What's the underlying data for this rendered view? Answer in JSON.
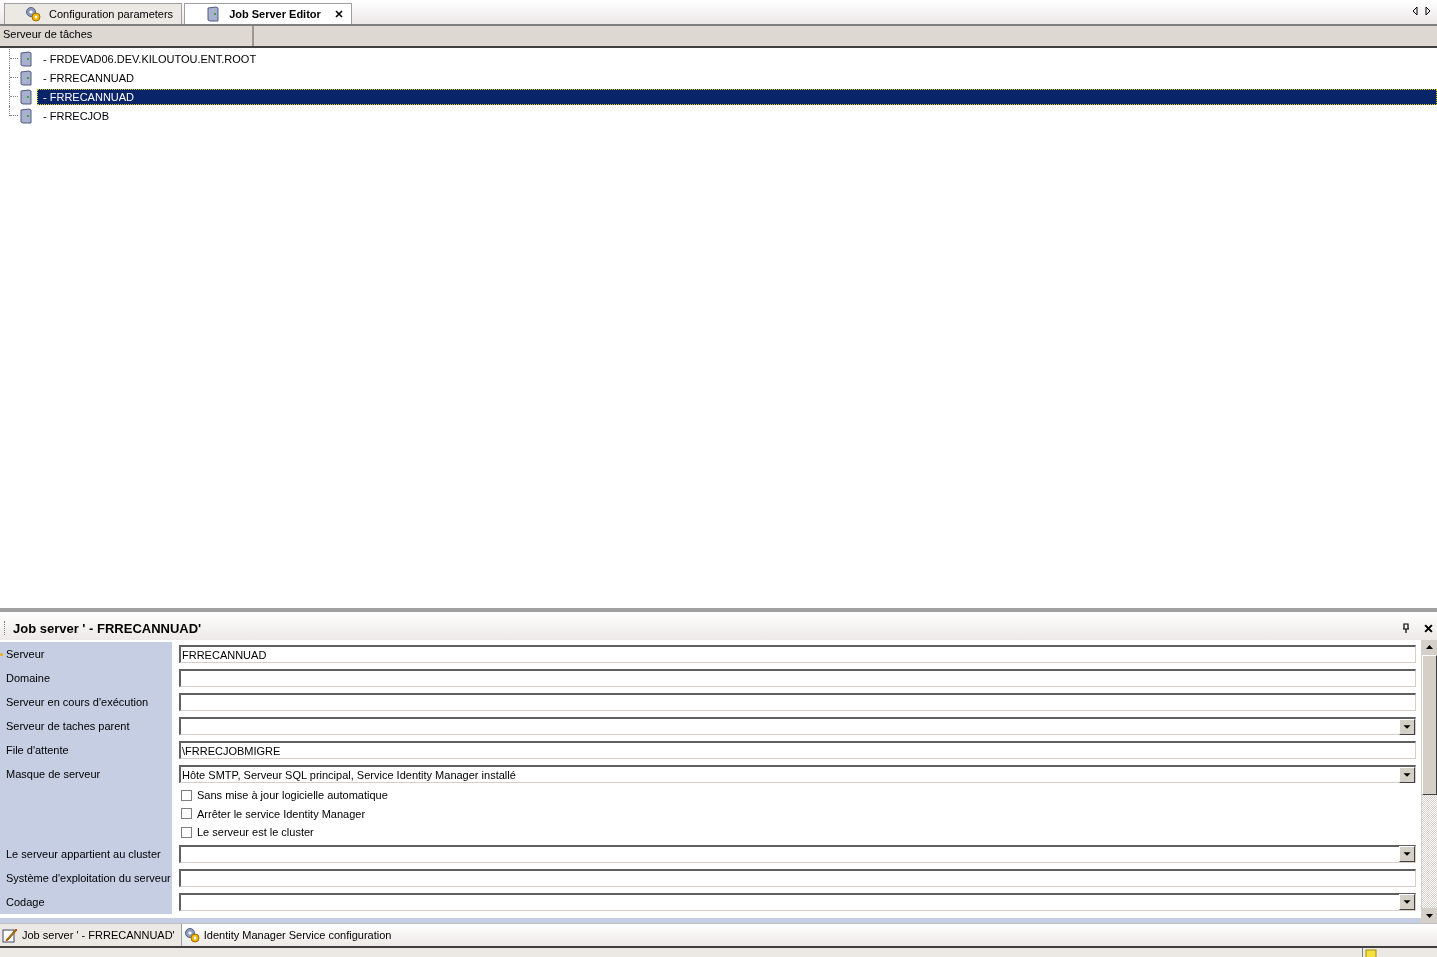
{
  "document_tabs": [
    {
      "label": "Configuration parameters",
      "selected": false
    },
    {
      "label": "Job Server Editor",
      "selected": true
    }
  ],
  "tree": {
    "column": "Serveur de tâches",
    "items": [
      {
        "label": "- FRDEVAD06.DEV.KILOUTOU.ENT.ROOT",
        "selected": false
      },
      {
        "label": "- FRRECANNUAD",
        "selected": false
      },
      {
        "label": "- FRRECANNUAD",
        "selected": true
      },
      {
        "label": "- FRRECJOB",
        "selected": false
      }
    ]
  },
  "panel": {
    "title": "Job server ' - FRRECANNUAD'",
    "fields": [
      {
        "kind": "text",
        "label": "Serveur",
        "value": "FRRECANNUAD",
        "required": true
      },
      {
        "kind": "text",
        "label": "Domaine",
        "required": false
      },
      {
        "kind": "text",
        "label": "Serveur en cours d'exécution",
        "required": false
      },
      {
        "kind": "combo",
        "label": "Serveur de taches parent",
        "required": false
      },
      {
        "kind": "text",
        "label": "File d'attente",
        "value": "\\FRRECJOBMIGRE",
        "required": false
      },
      {
        "kind": "combo",
        "label": "Masque de serveur",
        "value": "Hôte SMTP, Serveur SQL principal, Service Identity Manager installé",
        "required": false
      },
      {
        "kind": "checkbox",
        "label": "Sans mise à jour logicielle automatique",
        "checked": false
      },
      {
        "kind": "checkbox",
        "label": "Arrêter le service Identity Manager",
        "checked": false
      },
      {
        "kind": "checkbox",
        "label": "Le serveur est le cluster",
        "checked": false
      },
      {
        "kind": "combo",
        "label": "Le serveur appartient au cluster",
        "required": false
      },
      {
        "kind": "text",
        "label": "Système d'exploitation du serveur",
        "required": false
      },
      {
        "kind": "combo",
        "label": "Codage",
        "required": false
      }
    ]
  },
  "bottom_tabs": [
    {
      "label": "Job server ' - FRRECANNUAD'",
      "selected": true
    },
    {
      "label": "Identity Manager Service configuration",
      "selected": false
    }
  ]
}
